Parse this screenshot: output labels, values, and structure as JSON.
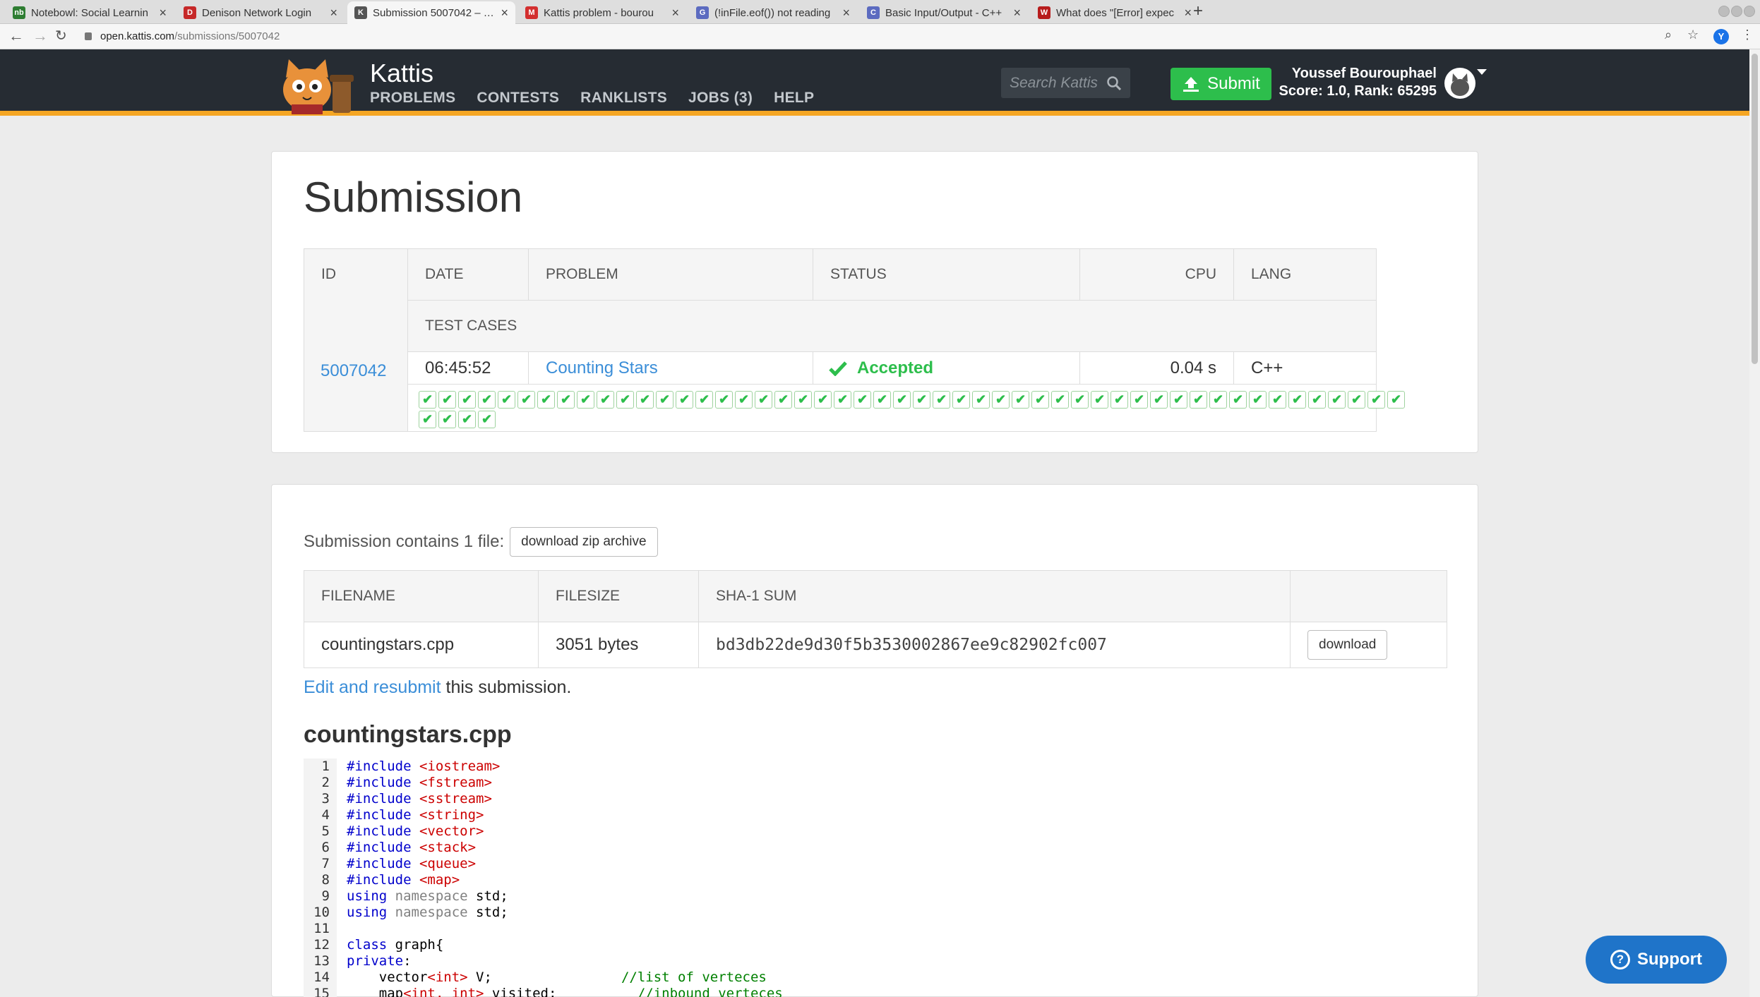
{
  "browser": {
    "tabs": [
      {
        "title": "Notebowl: Social Learnin",
        "favicon_color": "#2e7d32",
        "favicon_label": "nb"
      },
      {
        "title": "Denison Network Login",
        "favicon_color": "#c62828",
        "favicon_label": "D"
      },
      {
        "title": "Submission 5007042 – Kat",
        "favicon_color": "#555555",
        "favicon_label": "K",
        "active": true
      },
      {
        "title": "Kattis problem - bourou",
        "favicon_color": "#d32f2f",
        "favicon_label": "M"
      },
      {
        "title": "(!inFile.eof()) not reading",
        "favicon_color": "#5c6bc0",
        "favicon_label": "G"
      },
      {
        "title": "Basic Input/Output - C++",
        "favicon_color": "#5c6bc0",
        "favicon_label": "C"
      },
      {
        "title": "What does \"[Error] expec",
        "favicon_color": "#b71c1c",
        "favicon_label": "W"
      }
    ],
    "url_host": "open.kattis.com",
    "url_path": "/submissions/5007042",
    "profile_initial": "Y"
  },
  "header": {
    "brand": "Kattis",
    "nav": [
      "PROBLEMS",
      "CONTESTS",
      "RANKLISTS",
      "JOBS (3)",
      "HELP"
    ],
    "search_placeholder": "Search Kattis",
    "submit_label": "Submit",
    "user_name": "Youssef Bourouphael",
    "user_stats": "Score: 1.0, Rank: 65295",
    "accent_color": "#f5a623"
  },
  "submission": {
    "title": "Submission",
    "columns": {
      "id": "ID",
      "date": "DATE",
      "problem": "PROBLEM",
      "status": "STATUS",
      "cpu": "CPU",
      "lang": "LANG",
      "test_cases": "TEST CASES"
    },
    "id": "5007042",
    "date": "06:45:52",
    "problem": "Counting Stars",
    "status": "Accepted",
    "cpu": "0.04 s",
    "lang": "C++",
    "test_cases_passed": 54
  },
  "files": {
    "contains_text": "Submission contains 1 file:",
    "zip_button": "download zip archive",
    "columns": {
      "filename": "FILENAME",
      "filesize": "FILESIZE",
      "sha": "SHA-1 SUM"
    },
    "rows": [
      {
        "filename": "countingstars.cpp",
        "filesize": "3051 bytes",
        "sha": "bd3db22de9d30f5b3530002867ee9c82902fc007",
        "button": "download"
      }
    ],
    "resubmit_link": "Edit and resubmit",
    "resubmit_rest": " this submission.",
    "code_title": "countingstars.cpp"
  },
  "code_lines": [
    {
      "n": "1",
      "parts": [
        [
          "pp",
          "#include "
        ],
        [
          "str",
          "<iostream>"
        ]
      ]
    },
    {
      "n": "2",
      "parts": [
        [
          "pp",
          "#include "
        ],
        [
          "str",
          "<fstream>"
        ]
      ]
    },
    {
      "n": "3",
      "parts": [
        [
          "pp",
          "#include "
        ],
        [
          "str",
          "<sstream>"
        ]
      ]
    },
    {
      "n": "4",
      "parts": [
        [
          "pp",
          "#include "
        ],
        [
          "str",
          "<string>"
        ]
      ]
    },
    {
      "n": "5",
      "parts": [
        [
          "pp",
          "#include "
        ],
        [
          "str",
          "<vector>"
        ]
      ]
    },
    {
      "n": "6",
      "parts": [
        [
          "pp",
          "#include "
        ],
        [
          "str",
          "<stack>"
        ]
      ]
    },
    {
      "n": "7",
      "parts": [
        [
          "pp",
          "#include "
        ],
        [
          "str",
          "<queue>"
        ]
      ]
    },
    {
      "n": "8",
      "parts": [
        [
          "pp",
          "#include "
        ],
        [
          "str",
          "<map>"
        ]
      ]
    },
    {
      "n": "9",
      "parts": [
        [
          "kw",
          "using "
        ],
        [
          "ns",
          "namespace"
        ],
        [
          "",
          " std;"
        ]
      ]
    },
    {
      "n": "10",
      "parts": [
        [
          "kw",
          "using "
        ],
        [
          "ns",
          "namespace"
        ],
        [
          "",
          " std;"
        ]
      ]
    },
    {
      "n": "11",
      "parts": []
    },
    {
      "n": "12",
      "parts": [
        [
          "kw",
          "class"
        ],
        [
          "",
          " graph{"
        ]
      ]
    },
    {
      "n": "13",
      "parts": [
        [
          "kw",
          "private"
        ],
        [
          "",
          ":"
        ]
      ]
    },
    {
      "n": "14",
      "parts": [
        [
          "",
          "    vector"
        ],
        [
          "ty",
          "<int>"
        ],
        [
          "",
          " V;                "
        ],
        [
          "cm",
          "//list of verteces"
        ]
      ]
    },
    {
      "n": "15",
      "parts": [
        [
          "",
          "    map"
        ],
        [
          "ty",
          "<int, int>"
        ],
        [
          "",
          " visited;          "
        ],
        [
          "cm",
          "//inbound verteces"
        ]
      ]
    }
  ],
  "support_label": "Support"
}
